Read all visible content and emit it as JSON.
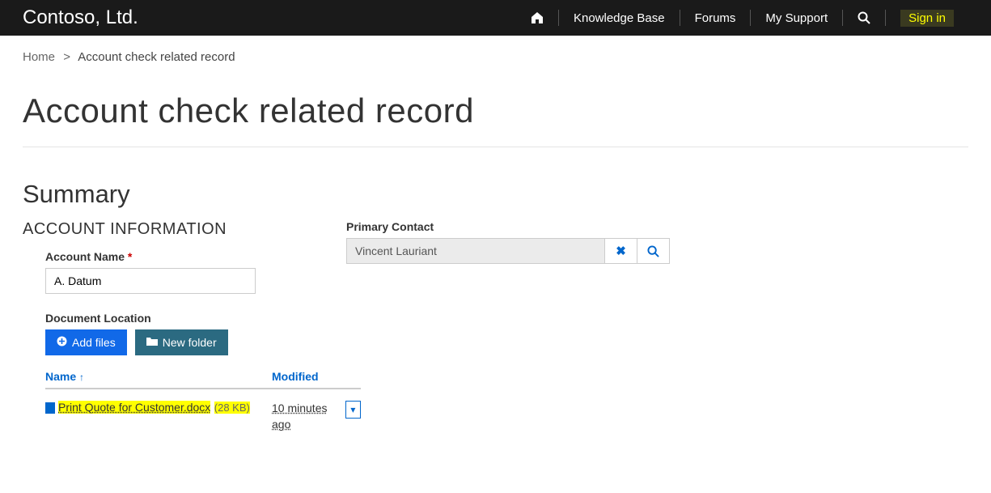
{
  "header": {
    "brand": "Contoso, Ltd.",
    "nav": {
      "knowledge_base": "Knowledge Base",
      "forums": "Forums",
      "my_support": "My Support",
      "sign_in": "Sign in"
    }
  },
  "breadcrumb": {
    "home": "Home",
    "current": "Account check related record"
  },
  "page_title": "Account check related record",
  "summary": {
    "heading": "Summary",
    "account_info_heading": "ACCOUNT INFORMATION",
    "account_name_label": "Account Name",
    "account_name_value": "A. Datum",
    "document_location_label": "Document Location",
    "add_files_label": "Add files",
    "new_folder_label": "New folder",
    "primary_contact_label": "Primary Contact",
    "primary_contact_value": "Vincent Lauriant"
  },
  "doc_table": {
    "col_name": "Name",
    "col_modified": "Modified",
    "rows": [
      {
        "name": "Print Quote for Customer.docx",
        "size": "(28 KB)",
        "modified": "10 minutes ago"
      }
    ]
  }
}
